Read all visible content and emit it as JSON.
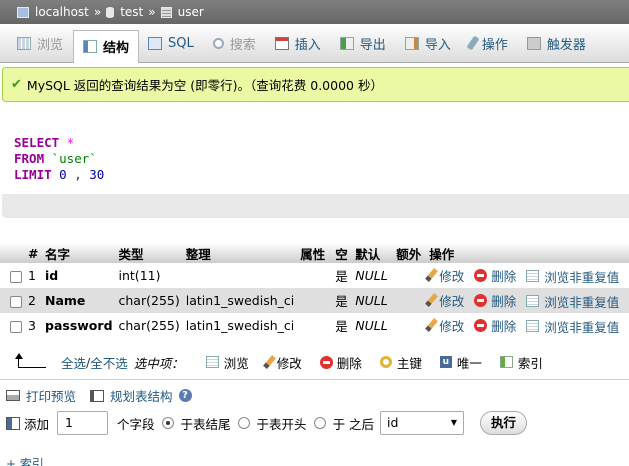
{
  "breadcrumb": {
    "server": "localhost",
    "database": "test",
    "table": "user",
    "separator": "»"
  },
  "tabs": [
    {
      "label": "浏览",
      "icon": "browse-icon",
      "state": "disabled"
    },
    {
      "label": "结构",
      "icon": "structure-icon",
      "state": "active"
    },
    {
      "label": "SQL",
      "icon": "sql-icon",
      "state": "normal"
    },
    {
      "label": "搜索",
      "icon": "search-icon",
      "state": "disabled"
    },
    {
      "label": "插入",
      "icon": "insert-icon",
      "state": "normal"
    },
    {
      "label": "导出",
      "icon": "export-icon",
      "state": "normal"
    },
    {
      "label": "导入",
      "icon": "import-icon",
      "state": "normal"
    },
    {
      "label": "操作",
      "icon": "operations-icon",
      "state": "normal"
    },
    {
      "label": "触发器",
      "icon": "triggers-icon",
      "state": "normal"
    }
  ],
  "message": {
    "text": "MySQL 返回的查询结果为空 (即零行)。（查询花费 0.0000 秒）"
  },
  "sql": {
    "line1_kw": "SELECT",
    "line1_rest": " *",
    "line2_kw": "FROM",
    "line2_rest": " `user`",
    "line3_kw": "LIMIT",
    "line3_a": " 0",
    "line3_sep": " , ",
    "line3_b": "30"
  },
  "table": {
    "headers": {
      "num": "#",
      "name": "名字",
      "type": "类型",
      "collation": "整理",
      "attributes": "属性",
      "null": "空",
      "default": "默认",
      "extra": "额外",
      "action": "操作"
    },
    "rows": [
      {
        "num": "1",
        "name": "id",
        "type": "int(11)",
        "collation": "",
        "attributes": "",
        "null": "是",
        "default": "NULL",
        "extra": ""
      },
      {
        "num": "2",
        "name": "Name",
        "type": "char(255)",
        "collation": "latin1_swedish_ci",
        "attributes": "",
        "null": "是",
        "default": "NULL",
        "extra": ""
      },
      {
        "num": "3",
        "name": "password",
        "type": "char(255)",
        "collation": "latin1_swedish_ci",
        "attributes": "",
        "null": "是",
        "default": "NULL",
        "extra": ""
      }
    ],
    "row_actions": {
      "edit": "修改",
      "delete": "删除",
      "browse_distinct": "浏览非重复值"
    }
  },
  "with_selected": {
    "check_all": "全选",
    "slash": " / ",
    "uncheck_all": "全不选",
    "label": "选中项：",
    "browse": "浏览",
    "edit": "修改",
    "delete": "删除",
    "primary": "主键",
    "unique": "唯一",
    "index": "索引"
  },
  "print": {
    "print_view": "打印预览",
    "propose": "规划表结构"
  },
  "add": {
    "label": "添加",
    "count": "1",
    "fields_label": "个字段",
    "end": "于表结尾",
    "begin": "于表开头",
    "after": "于 之后",
    "after_field": "id",
    "go": "执行"
  },
  "indexes_label": "+ 索引"
}
